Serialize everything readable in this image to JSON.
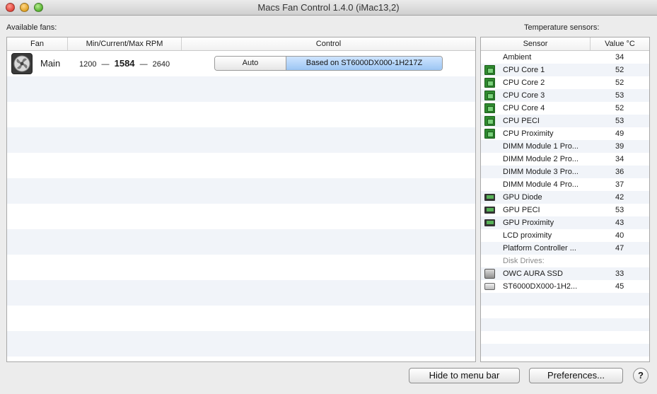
{
  "window": {
    "title": "Macs Fan Control 1.4.0 (iMac13,2)"
  },
  "fans_section": {
    "label": "Available fans:",
    "columns": [
      "Fan",
      "Min/Current/Max RPM",
      "Control"
    ],
    "rows": [
      {
        "name": "Main",
        "min_rpm": "1200",
        "sep1": "—",
        "current_rpm": "1584",
        "sep2": "—",
        "max_rpm": "2640",
        "control_options": [
          "Auto",
          "Based on ST6000DX000-1H217Z"
        ],
        "selected_control": "Based on ST6000DX000-1H217Z",
        "icon": "fan-icon"
      }
    ]
  },
  "sensors_section": {
    "label": "Temperature sensors:",
    "columns": [
      "Sensor",
      "Value °C"
    ],
    "rows": [
      {
        "icon": "none",
        "name": "Ambient",
        "value": "34"
      },
      {
        "icon": "cpu-chip-icon",
        "name": "CPU Core 1",
        "value": "52"
      },
      {
        "icon": "cpu-chip-icon",
        "name": "CPU Core 2",
        "value": "52"
      },
      {
        "icon": "cpu-chip-icon",
        "name": "CPU Core 3",
        "value": "53"
      },
      {
        "icon": "cpu-chip-icon",
        "name": "CPU Core 4",
        "value": "52"
      },
      {
        "icon": "cpu-chip-icon",
        "name": "CPU PECI",
        "value": "53"
      },
      {
        "icon": "cpu-chip-icon",
        "name": "CPU Proximity",
        "value": "49"
      },
      {
        "icon": "none",
        "name": "DIMM Module 1 Pro...",
        "value": "39"
      },
      {
        "icon": "none",
        "name": "DIMM Module 2 Pro...",
        "value": "34"
      },
      {
        "icon": "none",
        "name": "DIMM Module 3 Pro...",
        "value": "36"
      },
      {
        "icon": "none",
        "name": "DIMM Module 4 Pro...",
        "value": "37"
      },
      {
        "icon": "gpu-card-icon",
        "name": "GPU Diode",
        "value": "42"
      },
      {
        "icon": "gpu-card-icon",
        "name": "GPU PECI",
        "value": "53"
      },
      {
        "icon": "gpu-card-icon",
        "name": "GPU Proximity",
        "value": "43"
      },
      {
        "icon": "none",
        "name": "LCD proximity",
        "value": "40"
      },
      {
        "icon": "none",
        "name": "Platform Controller ...",
        "value": "47"
      },
      {
        "icon": "none",
        "name": "Disk Drives:",
        "value": "",
        "group": true
      },
      {
        "icon": "ssd-drive-icon",
        "name": "OWC AURA SSD",
        "value": "33"
      },
      {
        "icon": "hdd-drive-icon",
        "name": "ST6000DX000-1H2...",
        "value": "45"
      }
    ]
  },
  "buttons": {
    "hide": "Hide to menu bar",
    "preferences": "Preferences...",
    "help": "?"
  }
}
